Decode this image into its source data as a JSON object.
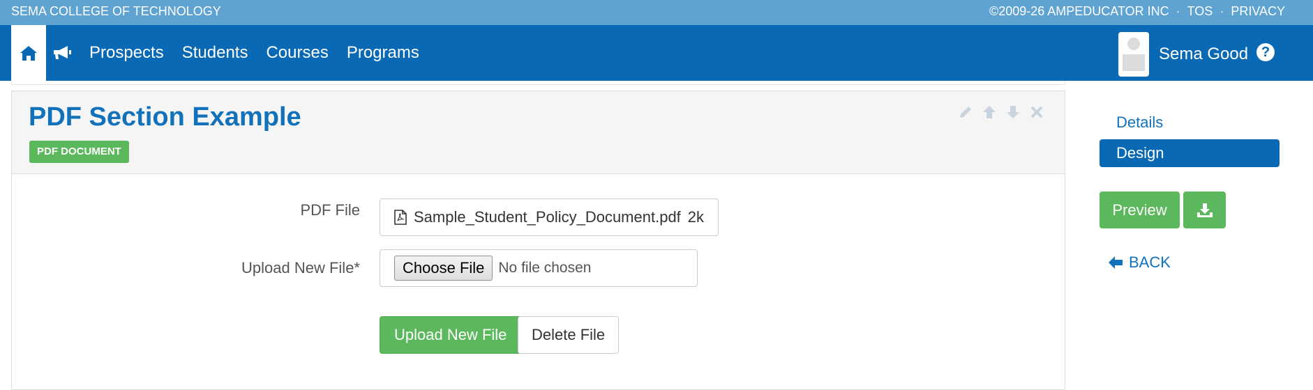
{
  "topbar": {
    "org": "SEMA COLLEGE OF TECHNOLOGY",
    "copyright": "©2009-26 AMPEDUCATOR INC",
    "tos": "TOS",
    "privacy": "PRIVACY",
    "separator": "·"
  },
  "nav": {
    "items": [
      "Prospects",
      "Students",
      "Courses",
      "Programs"
    ],
    "user_name": "Sema Good",
    "help": "?"
  },
  "section": {
    "title": "PDF Section Example",
    "badge": "PDF DOCUMENT"
  },
  "form": {
    "pdf_label": "PDF File",
    "pdf_filename": "Sample_Student_Policy_Document.pdf",
    "pdf_size": "2k",
    "upload_label": "Upload New File*",
    "choose_button": "Choose File",
    "no_file": "No file chosen",
    "upload_button": "Upload New File",
    "delete_button": "Delete File"
  },
  "sidebar": {
    "details": "Details",
    "design": "Design",
    "preview": "Preview",
    "back": "BACK"
  },
  "colors": {
    "brand_blue": "#0969b4",
    "topbar_blue": "#5fa3d3",
    "green": "#5cb85c",
    "title_blue": "#1271bb"
  }
}
